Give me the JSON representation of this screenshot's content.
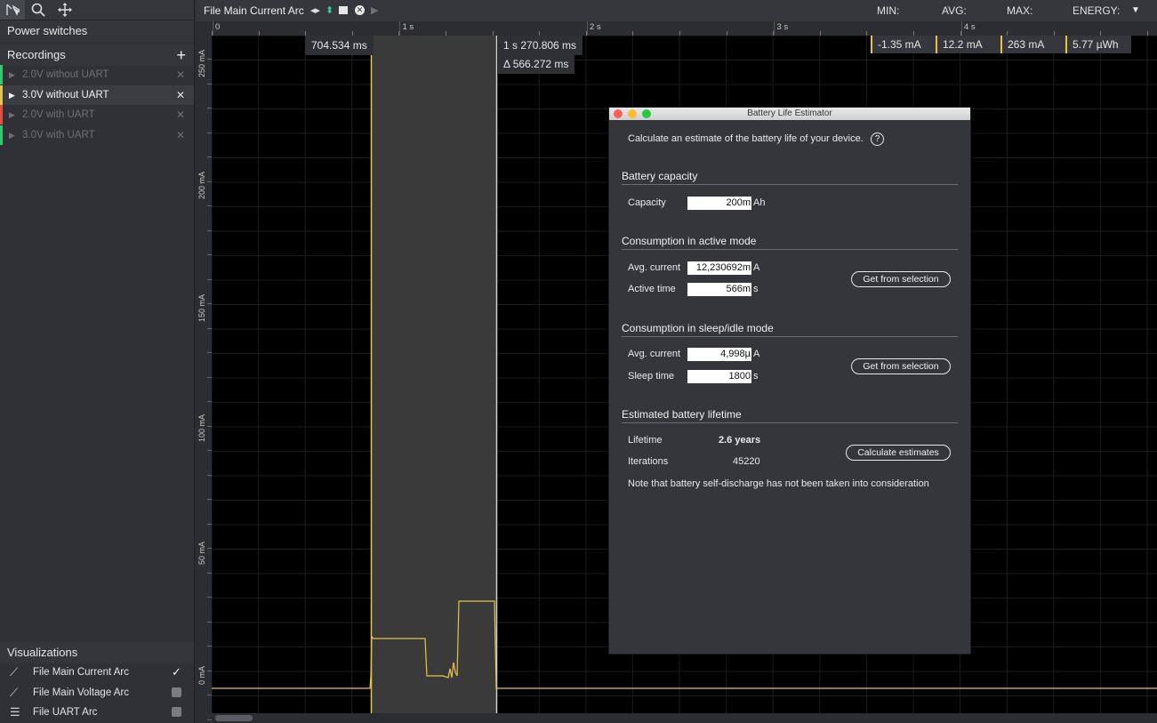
{
  "toolbar": {
    "tools": [
      "select-tool-icon",
      "zoom-icon",
      "pan-icon"
    ]
  },
  "sidebar": {
    "power_switches_label": "Power switches",
    "recordings_label": "Recordings",
    "recordings": [
      {
        "label": "2.0V without UART",
        "color": "#2ecc71",
        "active": false
      },
      {
        "label": "3.0V without UART",
        "color": "#e7c34a",
        "active": true
      },
      {
        "label": "2.0V with UART",
        "color": "#e74c3c",
        "active": false
      },
      {
        "label": "3.0V with UART",
        "color": "#2ecc71",
        "active": false
      }
    ],
    "visualizations_label": "Visualizations",
    "visualizations": [
      {
        "label": "File Main Current Arc",
        "icon": "line-chart-icon",
        "checked": true
      },
      {
        "label": "File Main Voltage Arc",
        "icon": "line-chart-icon",
        "checked": false
      },
      {
        "label": "File UART Arc",
        "icon": "list-icon",
        "checked": false
      }
    ]
  },
  "topbar": {
    "title": "File Main Current Arc",
    "min_label": "MIN:",
    "avg_label": "AVG:",
    "max_label": "MAX:",
    "energy_label": "ENERGY:",
    "min_value": "-1.35 mA",
    "avg_value": "12.2 mA",
    "max_value": "263 mA",
    "energy_value": "5.77 µWh"
  },
  "ruler": {
    "labels": [
      "0",
      "1 s",
      "2 s",
      "3 s",
      "4 s"
    ]
  },
  "yaxis": {
    "labels": [
      "250 mA",
      "200 mA",
      "150 mA",
      "100 mA",
      "50 mA",
      "0 mA"
    ]
  },
  "markers": {
    "start": "704.534 ms",
    "end": "1 s 270.806 ms",
    "delta": "Δ 566.272 ms"
  },
  "dialog": {
    "title": "Battery Life Estimator",
    "intro": "Calculate an estimate of the battery life of your device.",
    "battery_section": "Battery capacity",
    "capacity_label": "Capacity",
    "capacity_value": "200m",
    "capacity_unit": "Ah",
    "active_section": "Consumption in active mode",
    "active_current_label": "Avg. current",
    "active_current_value": "12,230692m",
    "active_current_unit": "A",
    "active_time_label": "Active time",
    "active_time_value": "566m",
    "active_time_unit": "s",
    "get_selection_label": "Get from selection",
    "sleep_section": "Consumption in sleep/idle mode",
    "sleep_current_label": "Avg. current",
    "sleep_current_value": "4,998µ",
    "sleep_current_unit": "A",
    "sleep_time_label": "Sleep time",
    "sleep_time_value": "1800",
    "sleep_time_unit": "s",
    "lifetime_section": "Estimated battery lifetime",
    "lifetime_label": "Lifetime",
    "lifetime_value": "2.6 years",
    "iterations_label": "Iterations",
    "iterations_value": "45220",
    "calculate_label": "Calculate estimates",
    "note": "Note that battery self-discharge has not been taken into consideration"
  }
}
